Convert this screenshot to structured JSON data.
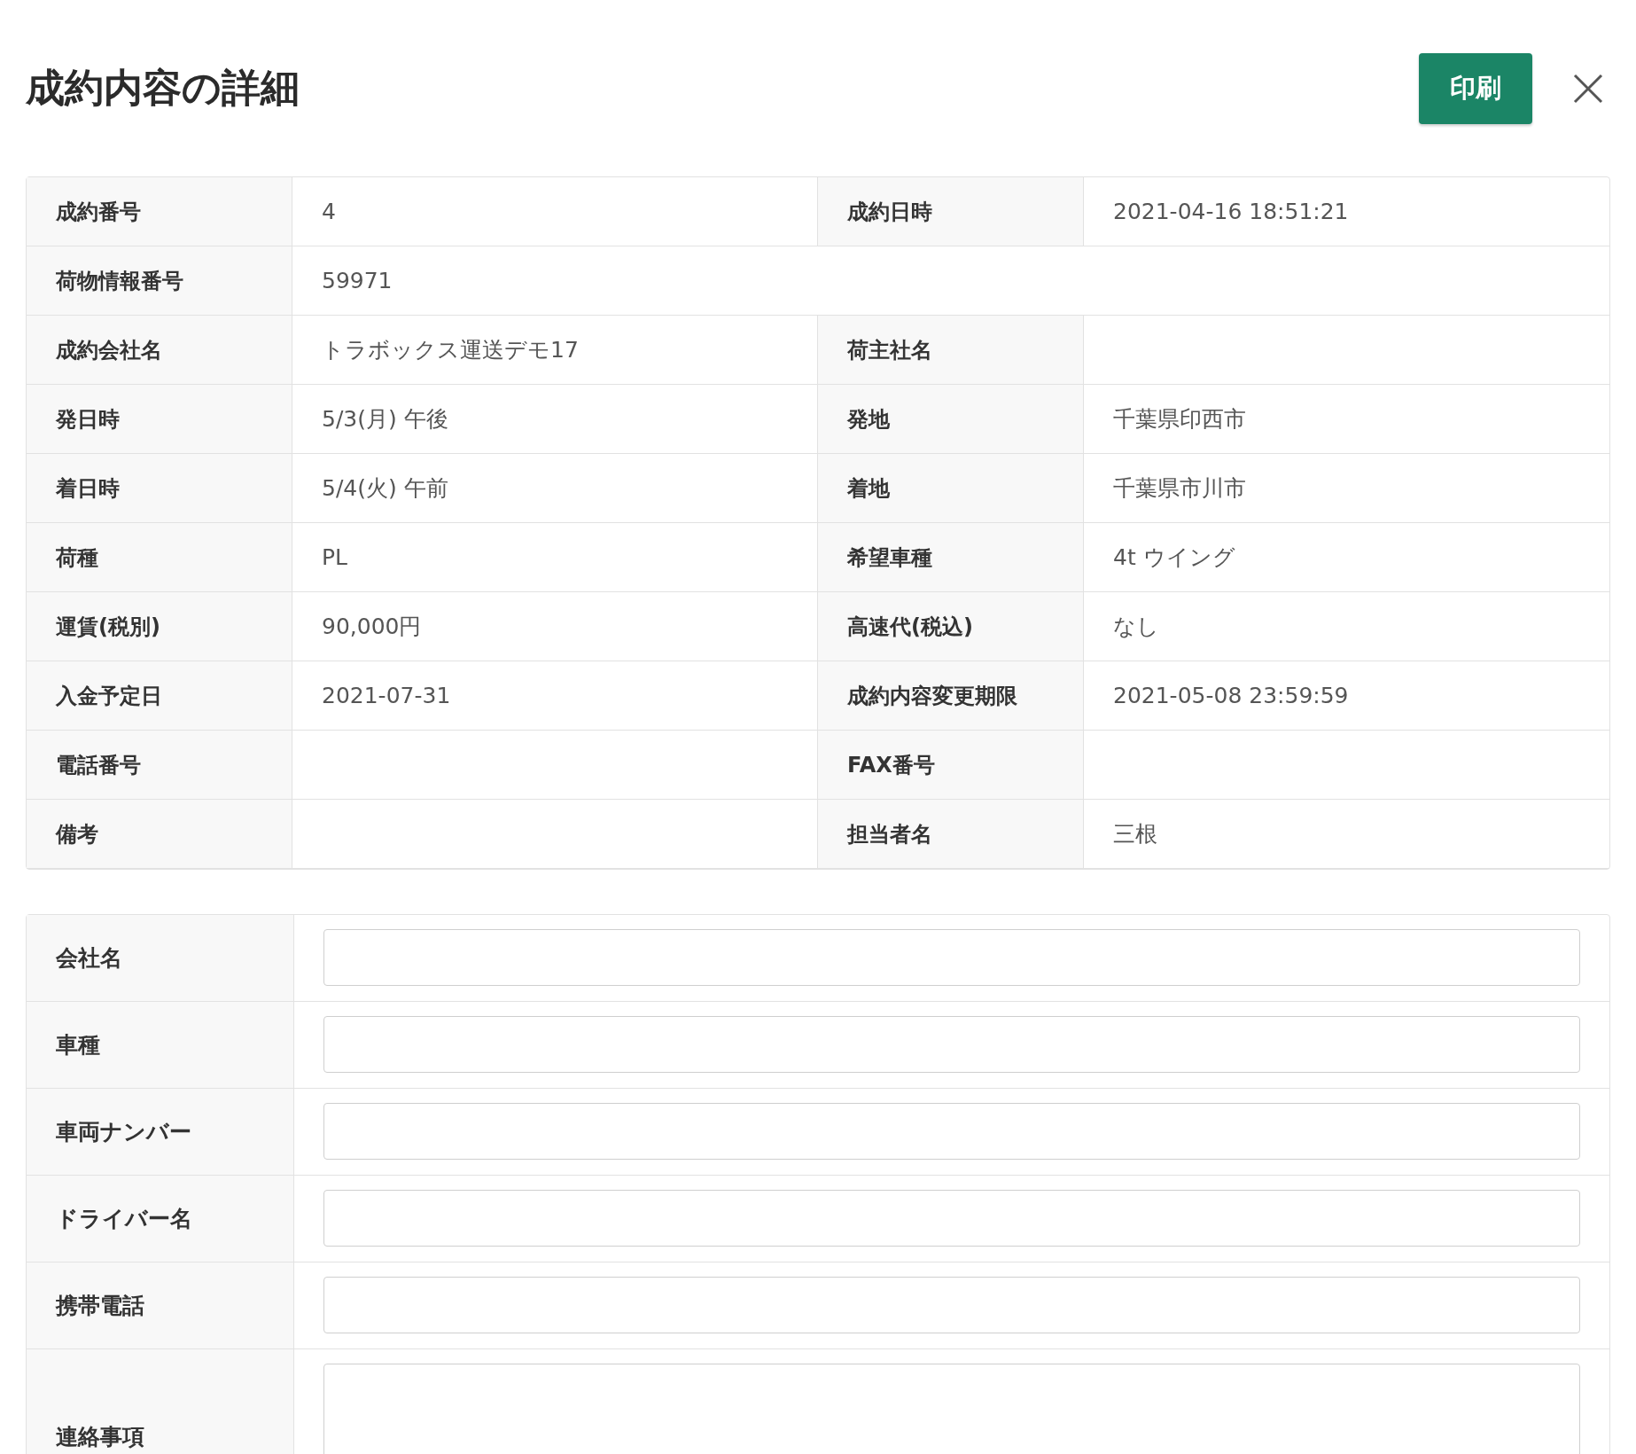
{
  "title": "成約内容の詳細",
  "print_button": "印刷",
  "info_table": {
    "rows": [
      {
        "fields": [
          {
            "label": "成約番号",
            "value": "4"
          },
          {
            "label": "成約日時",
            "value": "2021-04-16 18:51:21"
          }
        ]
      },
      {
        "fields": [
          {
            "label": "荷物情報番号",
            "value": "59971"
          }
        ]
      },
      {
        "fields": [
          {
            "label": "成約会社名",
            "value": "トラボックス運送デモ17"
          },
          {
            "label": "荷主社名"
          }
        ]
      },
      {
        "fields": [
          {
            "label": "発日時",
            "value": "5/3(月) 午後"
          },
          {
            "label": "発地",
            "value": "千葉県印西市"
          }
        ]
      },
      {
        "fields": [
          {
            "label": "着日時",
            "value": "5/4(火) 午前"
          },
          {
            "label": "着地",
            "value": "千葉県市川市"
          }
        ]
      },
      {
        "fields": [
          {
            "label": "荷種",
            "value": "PL"
          },
          {
            "label": "希望車種",
            "value": "4t ウイング"
          }
        ]
      },
      {
        "fields": [
          {
            "label": "運賃(税別)",
            "value": "90,000円"
          },
          {
            "label": "高速代(税込)",
            "value": "なし"
          }
        ]
      },
      {
        "fields": [
          {
            "label": "入金予定日",
            "value": "2021-07-31"
          },
          {
            "label": "成約内容変更期限",
            "value": "2021-05-08 23:59:59"
          }
        ]
      },
      {
        "fields": [
          {
            "label": "電話番号"
          },
          {
            "label": "FAX番号"
          }
        ]
      },
      {
        "fields": [
          {
            "label": "備考"
          },
          {
            "label": "担当者名",
            "value": "三根"
          }
        ]
      }
    ]
  },
  "form": {
    "fields": [
      {
        "label": "会社名",
        "kind": "input"
      },
      {
        "label": "車種",
        "kind": "input"
      },
      {
        "label": "車両ナンバー",
        "kind": "input"
      },
      {
        "label": "ドライバー名",
        "kind": "input"
      },
      {
        "label": "携帯電話",
        "kind": "input"
      },
      {
        "label": "連絡事項",
        "kind": "textarea"
      }
    ]
  }
}
